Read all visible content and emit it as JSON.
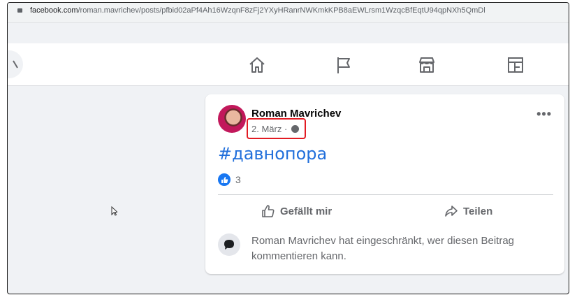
{
  "browser": {
    "url_host": "facebook.com",
    "url_path": "/roman.mavrichev/posts/pfbid02aPf4Ah16WzqnF8zFj2YXyHRanrNWKmkKPB8aEWLrsm1WzqcBfEqtU94qpNXh5QmDl"
  },
  "nav": {
    "icons": [
      "home-icon",
      "flag-icon",
      "marketplace-icon",
      "gaming-icon"
    ]
  },
  "post": {
    "author": "Roman Mavrichev",
    "date": "2. März",
    "date_sep": "·",
    "more_label": "•••",
    "hashtag": "#давнопора",
    "reaction_count": "3",
    "like_label": "Gefällt mir",
    "share_label": "Teilen",
    "comment_notice": "Roman Mavrichev hat eingeschränkt, wer diesen Beitrag kommentieren kann."
  },
  "colors": {
    "accent": "#1877f2",
    "link": "#216fdb",
    "highlight": "#e21b23",
    "background": "#f0f2f5"
  }
}
